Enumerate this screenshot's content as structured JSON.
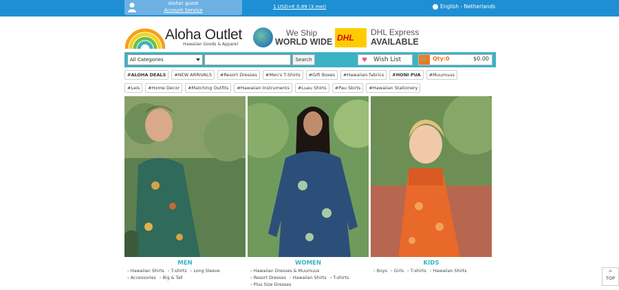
{
  "topbar": {
    "greeting": "Aloha! guest",
    "account_link": "Account Service",
    "exchange_rate": "1 USD=€ 0.89 (3 mei)",
    "language": "English - Netherlands"
  },
  "brand": {
    "name": "Aloha Outlet",
    "tagline": "Hawaiian Goods & Apparel"
  },
  "shipping": {
    "line1": "We Ship",
    "line2": "WORLD WIDE"
  },
  "dhl": {
    "logo_text": "DHL",
    "line1": "DHL Express",
    "line2": "AVAILABLE"
  },
  "search": {
    "category_selected": "All Categories",
    "query": "",
    "button": "Search"
  },
  "wishlist": {
    "label": "Wish List"
  },
  "cart": {
    "qty": "Qty:0",
    "amount": "$0.00"
  },
  "tags_row1": [
    "#ALOHA DEALS",
    "#NEW ARRIVALS",
    "#Resort Dresses",
    "#Men's T-Shirts",
    "#Gift Boxes",
    "#Hawaiian fabrics",
    "#HONI PUA",
    "#Muumuus"
  ],
  "tags_row2": [
    "#Leis",
    "#Home Decor",
    "#Matching Outfits",
    "#Hawaiian Instruments",
    "#Luau Shirts",
    "#Pau Skirts",
    "#Hawaiian Stationery"
  ],
  "categories": {
    "men": {
      "title": "MEN",
      "links": [
        "Hawaiian Shirts",
        "T-shirts",
        "Long Sleeve",
        "Accessories",
        "Big & Tall"
      ]
    },
    "women": {
      "title": "WOMEN",
      "links": [
        "Hawaiian Dresses & Muumuus",
        "Resort Dresses",
        "Hawaiian Shirts",
        "T-shirts",
        "Plus Size Dresses"
      ]
    },
    "kids": {
      "title": "KIDS",
      "links": [
        "Boys",
        "Girls",
        "T-shirts",
        "Hawaiian Shirts"
      ]
    }
  },
  "back_to_top": "TOP",
  "colors": {
    "topbar": "#1e8fd3",
    "accent": "#3bb3c3",
    "cart": "#f07a1a"
  }
}
